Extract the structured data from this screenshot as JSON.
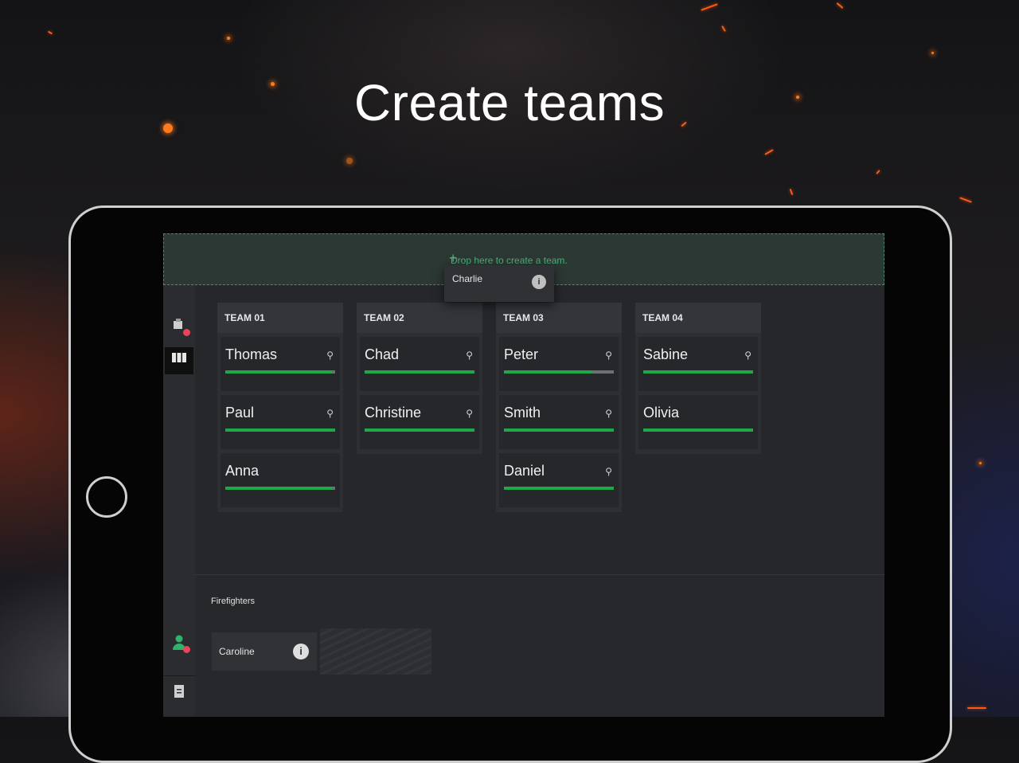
{
  "headline": "Create teams",
  "dropzone": {
    "hint": "Drop here to create a team."
  },
  "dragged": {
    "name": "Charlie",
    "icon": "person-info-icon"
  },
  "sidebar": {
    "items": [
      {
        "name": "vehicles",
        "icon": "vehicle-icon"
      },
      {
        "name": "teams",
        "icon": "columns-icon"
      },
      {
        "name": "firefighters",
        "icon": "person-icon"
      },
      {
        "name": "report",
        "icon": "document-icon"
      }
    ]
  },
  "teams": [
    {
      "title": "TEAM 01",
      "members": [
        {
          "name": "Thomas",
          "has_icon": true,
          "progress": 0.97
        },
        {
          "name": "Paul",
          "has_icon": true,
          "progress": 1.0
        },
        {
          "name": "Anna",
          "has_icon": false,
          "progress": 0.97
        }
      ]
    },
    {
      "title": "TEAM 02",
      "members": [
        {
          "name": "Chad",
          "has_icon": true,
          "progress": 1.0
        },
        {
          "name": "Christine",
          "has_icon": true,
          "progress": 1.0
        }
      ]
    },
    {
      "title": "TEAM 03",
      "members": [
        {
          "name": "Peter",
          "has_icon": true,
          "progress": 0.8
        },
        {
          "name": "Smith",
          "has_icon": true,
          "progress": 1.0
        },
        {
          "name": "Daniel",
          "has_icon": true,
          "progress": 1.0
        }
      ]
    },
    {
      "title": "TEAM 04",
      "members": [
        {
          "name": "Sabine",
          "has_icon": true,
          "progress": 1.0
        },
        {
          "name": "Olivia",
          "has_icon": false,
          "progress": 0.99
        }
      ]
    }
  ],
  "firefighters": {
    "title": "Firefighters",
    "items": [
      {
        "name": "Caroline",
        "icon": "info-icon"
      }
    ]
  },
  "colors": {
    "progress": "#1fa84a",
    "badge": "#e8455c",
    "dropzone": "#4caf7a"
  }
}
